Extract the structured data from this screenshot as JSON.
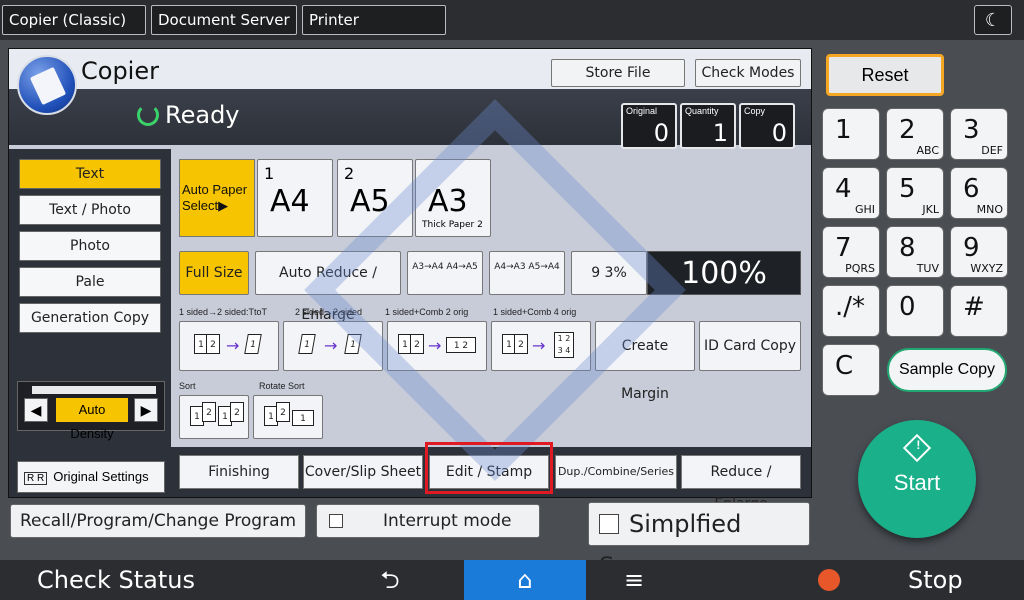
{
  "top_tabs": [
    "Copier (Classic)",
    "Document Server",
    "Printer"
  ],
  "moon_icon": "moon-icon",
  "header": {
    "title": "Copier",
    "status": "Ready",
    "store_file": "Store File",
    "check_modes": "Check Modes",
    "counters": [
      {
        "label": "Original",
        "value": "0"
      },
      {
        "label": "Quantity",
        "value": "1"
      },
      {
        "label": "Copy",
        "value": "0"
      }
    ]
  },
  "original_types": [
    "Text",
    "Text / Photo",
    "Photo",
    "Pale",
    "Generation Copy"
  ],
  "density": {
    "label": "Auto Density",
    "left": "◀",
    "right": "▶"
  },
  "original_settings": "Original Settings",
  "paper": {
    "auto": "Auto Paper Select▶",
    "trays": [
      {
        "num": "1",
        "size": "A4",
        "note": ""
      },
      {
        "num": "2",
        "size": "A5",
        "note": ""
      },
      {
        "num": "",
        "size": "A3",
        "note": "Thick Paper 2"
      }
    ]
  },
  "zoom": {
    "full_size": "Full Size",
    "auto_reduce": "Auto Reduce / Enlarge",
    "preset1": "A3→A4 A4→A5",
    "preset2": "A4→A3 A5→A4",
    "pct": "9 3%",
    "current": "100%"
  },
  "duplex": {
    "captions": [
      "1 sided→2 sided:TtoT",
      "2 sided→2 sided",
      "1 sided+Comb 2 orig",
      "1 sided+Comb 4 orig"
    ],
    "create_margin": "Create Margin",
    "id_card": "ID Card Copy"
  },
  "sort": {
    "sort": "Sort",
    "rotate_sort": "Rotate Sort"
  },
  "bottom_tabs": [
    "Finishing",
    "Cover/Slip Sheet",
    "Edit / Stamp",
    "Dup./Combine/Series",
    "Reduce / Enlarge"
  ],
  "recall": "Recall/Program/Change Program",
  "interrupt": "Interrupt mode",
  "simplified": "Simplfied Scrn.",
  "keypad": {
    "reset": "Reset",
    "keys": [
      {
        "d": "1",
        "l": ""
      },
      {
        "d": "2",
        "l": "ABC"
      },
      {
        "d": "3",
        "l": "DEF"
      },
      {
        "d": "4",
        "l": "GHI"
      },
      {
        "d": "5",
        "l": "JKL"
      },
      {
        "d": "6",
        "l": "MNO"
      },
      {
        "d": "7",
        "l": "PQRS"
      },
      {
        "d": "8",
        "l": "TUV"
      },
      {
        "d": "9",
        "l": "WXYZ"
      },
      {
        "d": "./*",
        "l": ""
      },
      {
        "d": "0",
        "l": ""
      },
      {
        "d": "#",
        "l": ""
      }
    ],
    "clear": "C",
    "sample_copy": "Sample Copy",
    "start": "Start"
  },
  "statusbar": {
    "check_status": "Check Status",
    "back": "⮌",
    "home": "⌂",
    "menu": "≡",
    "stop": "Stop"
  },
  "colors": {
    "selected": "#f6c400",
    "start": "#1ab08a",
    "highlight": "#e01a22",
    "home": "#1a7bd8"
  }
}
